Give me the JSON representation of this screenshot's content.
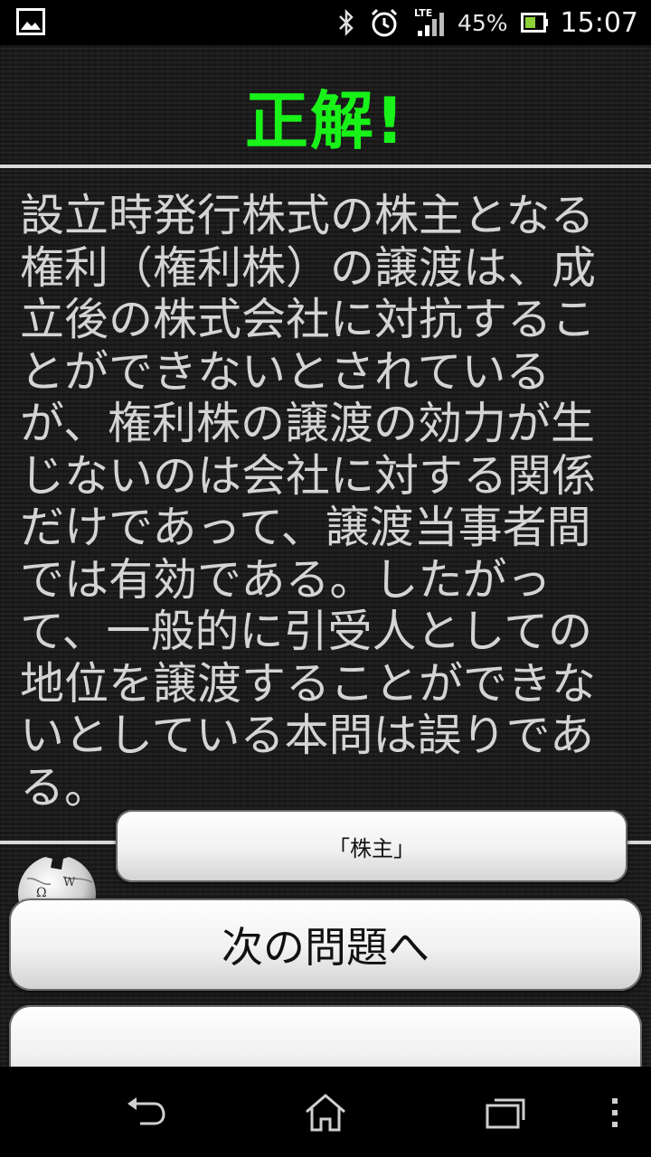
{
  "status_bar": {
    "network": "LTE",
    "battery_percent": "45%",
    "time": "15:07",
    "icons": [
      "gallery-icon",
      "bluetooth-icon",
      "alarm-icon",
      "signal-icon",
      "battery-icon"
    ]
  },
  "result": {
    "title": "正解!",
    "color": "#19f219"
  },
  "explanation": "設立時発行株式の株主となる権利（権利株）の譲渡は、成立後の株式会社に対抗することができないとされているが、権利株の譲渡の効力が生じないのは会社に対する関係だけであって、譲渡当事者間では有効である。したがって、一般的に引受人としての地位を譲渡することができないとしている本問は誤りである。",
  "wikipedia": {
    "icon": "wikipedia-globe-icon",
    "term_button_label": "「株主」"
  },
  "actions": {
    "next_label": "次の問題へ"
  },
  "navbar": {
    "icons": [
      "back-icon",
      "home-icon",
      "recent-apps-icon",
      "menu-icon"
    ]
  }
}
